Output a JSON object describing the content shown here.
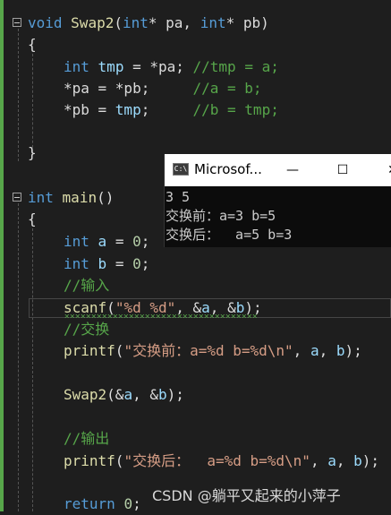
{
  "editor": {
    "lines": [
      {
        "segments": [
          {
            "t": "void",
            "c": "kw"
          },
          {
            "t": " "
          },
          {
            "t": "Swap2",
            "c": "fn"
          },
          {
            "t": "("
          },
          {
            "t": "int",
            "c": "kw"
          },
          {
            "t": "* pa, "
          },
          {
            "t": "int",
            "c": "kw"
          },
          {
            "t": "* pb)"
          }
        ]
      },
      {
        "segments": [
          {
            "t": "{"
          }
        ]
      },
      {
        "segments": [
          {
            "t": "int",
            "c": "kw"
          },
          {
            "t": " "
          },
          {
            "t": "tmp",
            "c": "vr"
          },
          {
            "t": " = *pa; "
          },
          {
            "t": "//tmp = a;",
            "c": "cm"
          }
        ]
      },
      {
        "segments": [
          {
            "t": "*pa = *pb;     "
          },
          {
            "t": "//a = b;",
            "c": "cm"
          }
        ]
      },
      {
        "segments": [
          {
            "t": "*pb = "
          },
          {
            "t": "tmp",
            "c": "vr"
          },
          {
            "t": ";     "
          },
          {
            "t": "//b = tmp;",
            "c": "cm"
          }
        ]
      },
      {
        "segments": [
          {
            "t": "}"
          }
        ]
      },
      {
        "segments": [
          {
            "t": "int",
            "c": "kw"
          },
          {
            "t": " "
          },
          {
            "t": "main",
            "c": "fn"
          },
          {
            "t": "()"
          }
        ]
      },
      {
        "segments": [
          {
            "t": "{"
          }
        ]
      },
      {
        "segments": [
          {
            "t": "int",
            "c": "kw"
          },
          {
            "t": " "
          },
          {
            "t": "a",
            "c": "vr"
          },
          {
            "t": " = "
          },
          {
            "t": "0",
            "c": "nm"
          },
          {
            "t": ";"
          }
        ]
      },
      {
        "segments": [
          {
            "t": "int",
            "c": "kw"
          },
          {
            "t": " "
          },
          {
            "t": "b",
            "c": "vr"
          },
          {
            "t": " = "
          },
          {
            "t": "0",
            "c": "nm"
          },
          {
            "t": ";"
          }
        ]
      },
      {
        "segments": [
          {
            "t": "//输入",
            "c": "cm"
          }
        ]
      },
      {
        "segments": [
          {
            "t": "scanf",
            "c": "fn"
          },
          {
            "t": "("
          },
          {
            "t": "\"%d %d\"",
            "c": "st"
          },
          {
            "t": ", &"
          },
          {
            "t": "a",
            "c": "vr"
          },
          {
            "t": ", &"
          },
          {
            "t": "b",
            "c": "vr"
          },
          {
            "t": ");"
          }
        ]
      },
      {
        "segments": [
          {
            "t": "//交换",
            "c": "cm"
          }
        ]
      },
      {
        "segments": [
          {
            "t": "printf",
            "c": "fn"
          },
          {
            "t": "("
          },
          {
            "t": "\"交换前：a=%d b=%d\\n\"",
            "c": "st"
          },
          {
            "t": ", "
          },
          {
            "t": "a",
            "c": "vr"
          },
          {
            "t": ", "
          },
          {
            "t": "b",
            "c": "vr"
          },
          {
            "t": ");"
          }
        ]
      },
      {
        "segments": [
          {
            "t": "Swap2",
            "c": "fn"
          },
          {
            "t": "(&"
          },
          {
            "t": "a",
            "c": "vr"
          },
          {
            "t": ", &"
          },
          {
            "t": "b",
            "c": "vr"
          },
          {
            "t": ");"
          }
        ]
      },
      {
        "segments": [
          {
            "t": "//输出",
            "c": "cm"
          }
        ]
      },
      {
        "segments": [
          {
            "t": "printf",
            "c": "fn"
          },
          {
            "t": "("
          },
          {
            "t": "\"交换后：  a=%d b=%d\\n\"",
            "c": "st"
          },
          {
            "t": ", "
          },
          {
            "t": "a",
            "c": "vr"
          },
          {
            "t": ", "
          },
          {
            "t": "b",
            "c": "vr"
          },
          {
            "t": ");"
          }
        ]
      },
      {
        "segments": [
          {
            "t": "return",
            "c": "kw"
          },
          {
            "t": " "
          },
          {
            "t": "0",
            "c": "nm"
          },
          {
            "t": ";"
          }
        ]
      }
    ]
  },
  "console": {
    "icon_label": "C:\\",
    "title": "Microsof...",
    "minimize": "—",
    "maximize": "☐",
    "close": "✕",
    "output": [
      "3 5",
      "交换前：a=3 b=5",
      "交换后：  a=5 b=3"
    ]
  },
  "watermark": "CSDN @躺平又起来的小萍子",
  "colors": {
    "background": "#1e1e1e",
    "keyword": "#569cd6",
    "function": "#dcdcaa",
    "variable": "#9cdcfe",
    "comment": "#57a64a",
    "string": "#d69d85",
    "number": "#b5cea8"
  }
}
